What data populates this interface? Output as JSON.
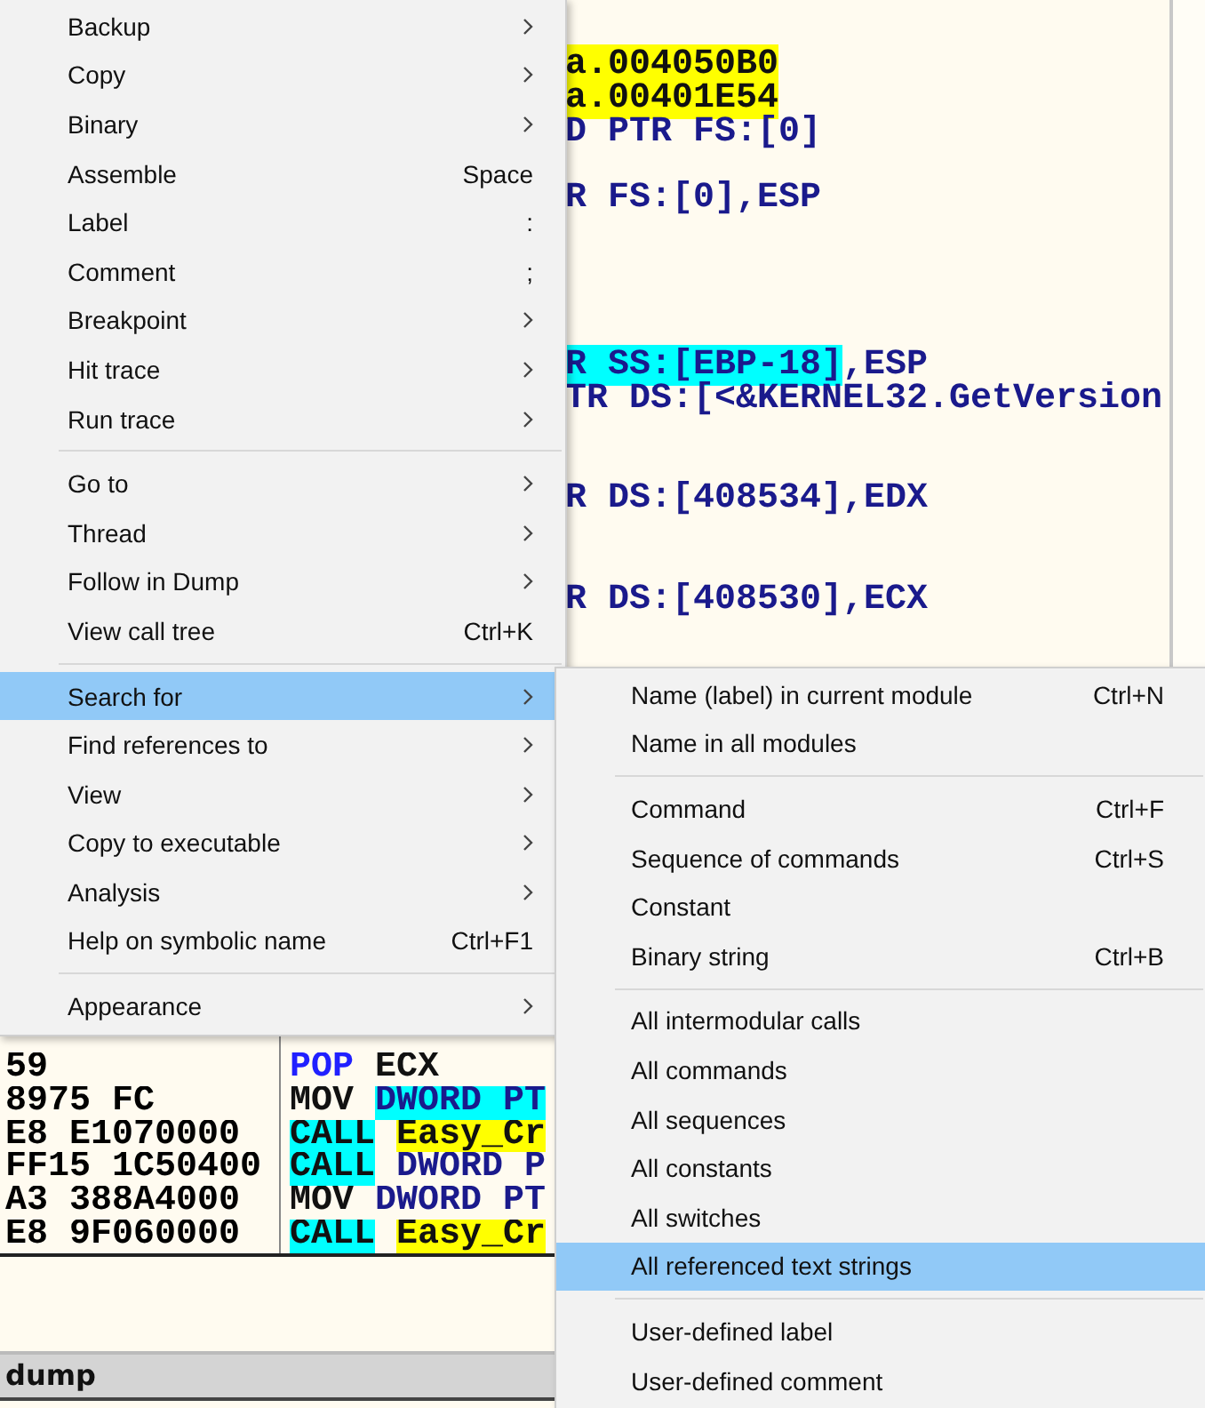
{
  "code_rows": [
    {
      "tail": [
        {
          "text": "a.004050B0",
          "kind": "target"
        }
      ]
    },
    {
      "tail": [
        {
          "text": "a.00401E54",
          "kind": "target"
        }
      ]
    },
    {
      "tail": [
        {
          "text": "D PTR FS:[0]",
          "kind": "mem"
        }
      ]
    },
    {},
    {
      "tail": [
        {
          "text": "R FS:[0],ESP",
          "kind": "mem"
        }
      ]
    },
    {},
    {},
    {},
    {},
    {
      "tail": [
        {
          "text": "R SS:[EBP-18]",
          "kind": "memhl"
        },
        {
          "text": ",ESP",
          "kind": "mem"
        }
      ]
    },
    {
      "tail": [
        {
          "text": "TR DS:[<&KERNEL32.GetVersion",
          "kind": "mem"
        }
      ]
    },
    {},
    {},
    {
      "tail": [
        {
          "text": "R DS:[408534],EDX",
          "kind": "mem"
        }
      ]
    },
    {},
    {},
    {
      "tail": [
        {
          "text": "R DS:[408530],ECX",
          "kind": "mem"
        }
      ]
    },
    {},
    {},
    {},
    {},
    {},
    {},
    {},
    {},
    {},
    {},
    {},
    {},
    {},
    {
      "hex": "59",
      "op": {
        "text": "POP",
        "kind": "stack"
      },
      "args": [
        {
          "text": "ECX",
          "kind": "plain"
        }
      ]
    },
    {
      "hex": "8975 FC",
      "op": {
        "text": "MOV",
        "kind": "plain"
      },
      "args": [
        {
          "text": "DWORD PT",
          "kind": "memhl"
        }
      ]
    },
    {
      "hex": "E8 E1070000",
      "op": {
        "text": "CALL",
        "kind": "call"
      },
      "args": [
        {
          "text": "Easy_Cr",
          "kind": "target"
        }
      ]
    },
    {
      "hex": "FF15 1C50400",
      "op": {
        "text": "CALL",
        "kind": "call"
      },
      "args": [
        {
          "text": "DWORD P",
          "kind": "mem"
        }
      ]
    },
    {
      "hex": "A3 388A4000",
      "op": {
        "text": "MOV",
        "kind": "plain"
      },
      "args": [
        {
          "text": "DWORD PT",
          "kind": "mem"
        }
      ]
    },
    {
      "hex": "E8 9F060000",
      "op": {
        "text": "CALL",
        "kind": "call"
      },
      "args": [
        {
          "text": "Easy_Cr",
          "kind": "target"
        }
      ]
    }
  ],
  "dump_title": "dump",
  "menu": {
    "groups": [
      {
        "items": [
          {
            "label": "Backup",
            "submenu": true,
            "selected": false
          },
          {
            "label": "Copy",
            "submenu": true,
            "selected": false
          },
          {
            "label": "Binary",
            "submenu": true,
            "selected": false
          },
          {
            "label": "Assemble",
            "shortcut": "Space",
            "submenu": false,
            "selected": false
          },
          {
            "label": "Label",
            "shortcut": ":",
            "submenu": false,
            "selected": false
          },
          {
            "label": "Comment",
            "shortcut": ";",
            "submenu": false,
            "selected": false
          },
          {
            "label": "Breakpoint",
            "submenu": true,
            "selected": false
          },
          {
            "label": "Hit trace",
            "submenu": true,
            "selected": false
          },
          {
            "label": "Run trace",
            "submenu": true,
            "selected": false
          }
        ]
      },
      {
        "items": [
          {
            "label": "Go to",
            "submenu": true,
            "selected": false
          },
          {
            "label": "Thread",
            "submenu": true,
            "selected": false
          },
          {
            "label": "Follow in Dump",
            "submenu": true,
            "selected": false
          },
          {
            "label": "View call tree",
            "shortcut": "Ctrl+K",
            "submenu": false,
            "selected": false
          }
        ]
      },
      {
        "items": [
          {
            "label": "Search for",
            "submenu": true,
            "selected": true
          },
          {
            "label": "Find references to",
            "submenu": true,
            "selected": false
          },
          {
            "label": "View",
            "submenu": true,
            "selected": false
          },
          {
            "label": "Copy to executable",
            "submenu": true,
            "selected": false
          },
          {
            "label": "Analysis",
            "submenu": true,
            "selected": false
          },
          {
            "label": "Help on symbolic name",
            "shortcut": "Ctrl+F1",
            "submenu": false,
            "selected": false
          }
        ]
      },
      {
        "items": [
          {
            "label": "Appearance",
            "submenu": true,
            "selected": false
          }
        ]
      }
    ]
  },
  "submenu": {
    "groups": [
      {
        "items": [
          {
            "label": "Name (label) in current module",
            "shortcut": "Ctrl+N",
            "selected": false
          },
          {
            "label": "Name in all modules",
            "selected": false
          }
        ]
      },
      {
        "items": [
          {
            "label": "Command",
            "shortcut": "Ctrl+F",
            "selected": false
          },
          {
            "label": "Sequence of commands",
            "shortcut": "Ctrl+S",
            "selected": false
          },
          {
            "label": "Constant",
            "selected": false
          },
          {
            "label": "Binary string",
            "shortcut": "Ctrl+B",
            "selected": false
          }
        ]
      },
      {
        "items": [
          {
            "label": "All intermodular calls",
            "selected": false
          },
          {
            "label": "All commands",
            "selected": false
          },
          {
            "label": "All sequences",
            "selected": false
          },
          {
            "label": "All constants",
            "selected": false
          },
          {
            "label": "All switches",
            "selected": false
          },
          {
            "label": "All referenced text strings",
            "selected": true
          }
        ]
      },
      {
        "items": [
          {
            "label": "User-defined label",
            "selected": false
          },
          {
            "label": "User-defined comment",
            "selected": false
          }
        ]
      }
    ]
  }
}
